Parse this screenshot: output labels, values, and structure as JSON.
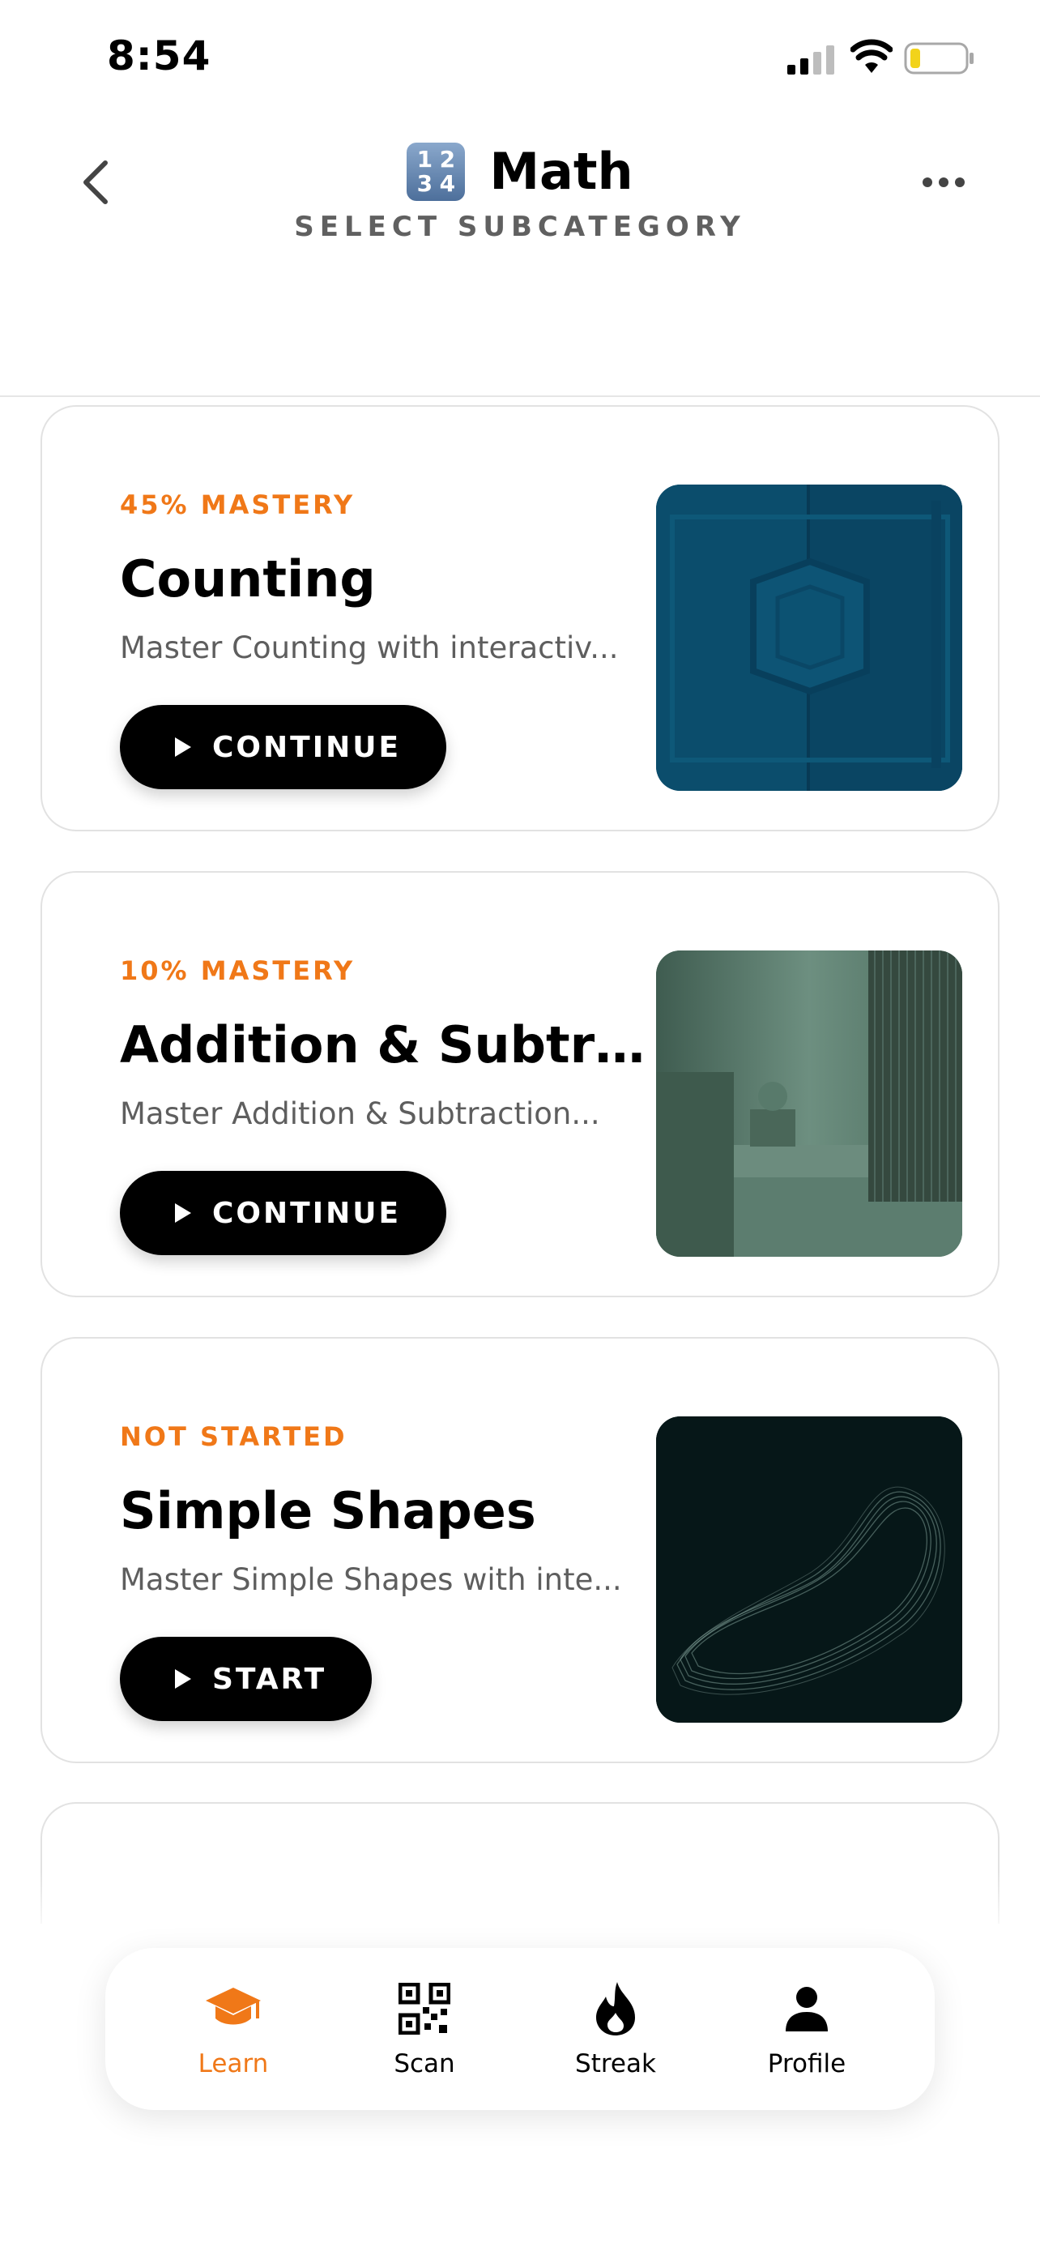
{
  "status_bar": {
    "time": "8:54"
  },
  "header": {
    "icon_text": [
      "1",
      "2",
      "3",
      "4"
    ],
    "title": "Math",
    "subtitle": "SELECT SUBCATEGORY"
  },
  "cards": [
    {
      "status": "45% MASTERY",
      "title": "Counting",
      "description": "Master Counting with interactiv...",
      "button": "CONTINUE",
      "mastery_percent": 45
    },
    {
      "status": "10% MASTERY",
      "title": "Addition & Subtra...",
      "description": "Master Addition & Subtraction...",
      "button": "CONTINUE",
      "mastery_percent": 10
    },
    {
      "status": "NOT STARTED",
      "title": "Simple Shapes",
      "description": "Master Simple Shapes with inte...",
      "button": "START",
      "mastery_percent": 0
    }
  ],
  "tabs": [
    {
      "label": "Learn",
      "icon": "graduation-cap-icon",
      "active": true
    },
    {
      "label": "Scan",
      "icon": "qr-code-icon",
      "active": false
    },
    {
      "label": "Streak",
      "icon": "flame-icon",
      "active": false
    },
    {
      "label": "Profile",
      "icon": "person-icon",
      "active": false
    }
  ],
  "colors": {
    "accent": "#f07818",
    "button": "#000000",
    "muted_text": "#5e5e5e"
  }
}
